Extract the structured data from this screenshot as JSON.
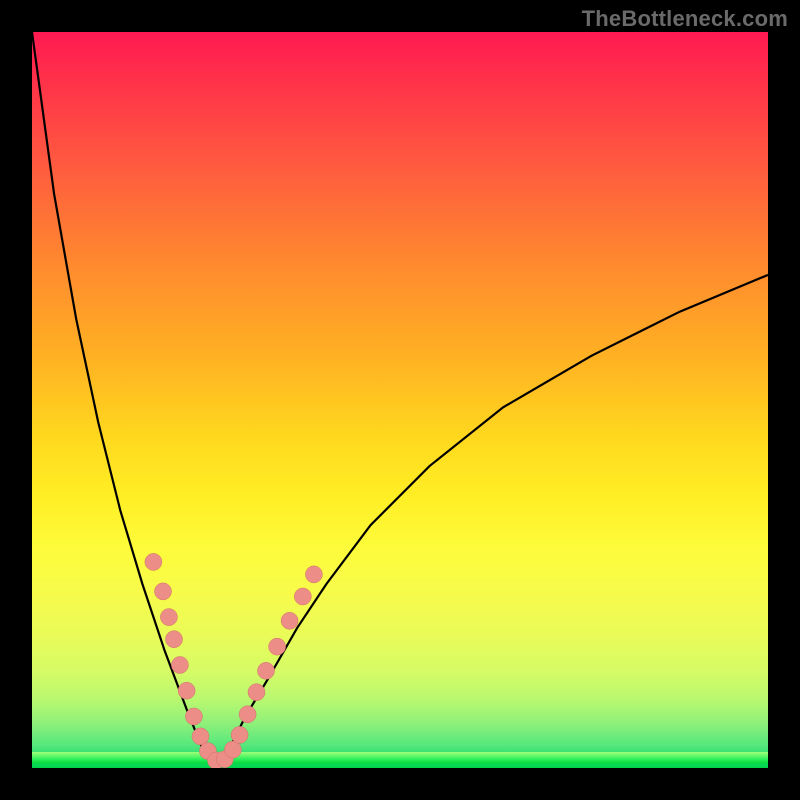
{
  "watermark": "TheBottleneck.com",
  "colors": {
    "background_black": "#000000",
    "gradient_top": "#ff1a52",
    "gradient_bottom": "#00d44a",
    "curve": "#000000",
    "marker_fill": "#ec8d87",
    "marker_stroke": "#d07068",
    "watermark_text": "#6a6a6a"
  },
  "chart_data": {
    "type": "line",
    "title": "",
    "xlabel": "",
    "ylabel": "",
    "xlim": [
      0,
      100
    ],
    "ylim": [
      0,
      100
    ],
    "notes": "V-shaped bottleneck curve; y = 100 * |((x/100)^0.6 - 0.39)| / max(0.39, 1-0.39) approximated. Minimum ≈ 0 at x ≈ 25. Background is a vertical bottleneck heatmap from red (top, high bottleneck) through yellow to green (bottom, low bottleneck).",
    "series": [
      {
        "name": "bottleneck_curve",
        "x": [
          0,
          3,
          6,
          9,
          12,
          15,
          18,
          21,
          23,
          25,
          27,
          29,
          32,
          36,
          40,
          46,
          54,
          64,
          76,
          88,
          100
        ],
        "y": [
          100,
          78,
          61,
          47,
          35,
          25,
          16,
          8,
          3,
          0,
          3,
          7,
          12,
          19,
          25,
          33,
          41,
          49,
          56,
          62,
          67
        ]
      }
    ],
    "markers": [
      {
        "x": 16.5,
        "y": 28
      },
      {
        "x": 17.8,
        "y": 24
      },
      {
        "x": 18.6,
        "y": 20.5
      },
      {
        "x": 19.3,
        "y": 17.5
      },
      {
        "x": 20.1,
        "y": 14
      },
      {
        "x": 21.0,
        "y": 10.5
      },
      {
        "x": 22.0,
        "y": 7
      },
      {
        "x": 22.9,
        "y": 4.3
      },
      {
        "x": 23.9,
        "y": 2.3
      },
      {
        "x": 25.0,
        "y": 1.0
      },
      {
        "x": 26.2,
        "y": 1.2
      },
      {
        "x": 27.3,
        "y": 2.5
      },
      {
        "x": 28.2,
        "y": 4.5
      },
      {
        "x": 29.3,
        "y": 7.3
      },
      {
        "x": 30.5,
        "y": 10.3
      },
      {
        "x": 31.8,
        "y": 13.2
      },
      {
        "x": 33.3,
        "y": 16.5
      },
      {
        "x": 35.0,
        "y": 20
      },
      {
        "x": 36.8,
        "y": 23.3
      },
      {
        "x": 38.3,
        "y": 26.3
      }
    ]
  }
}
